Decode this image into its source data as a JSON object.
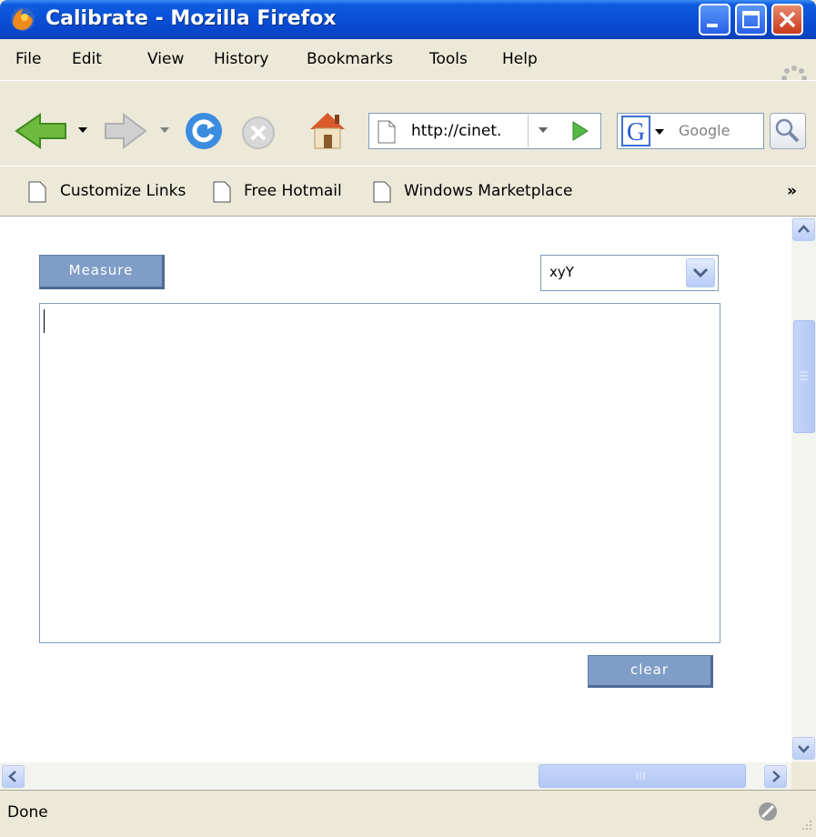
{
  "window": {
    "title": "Calibrate - Mozilla Firefox"
  },
  "menubar": {
    "items": [
      "File",
      "Edit",
      "View",
      "History",
      "Bookmarks",
      "Tools",
      "Help"
    ]
  },
  "navbar": {
    "url": "http://cinet.",
    "search_placeholder": "Google"
  },
  "bookmarks": {
    "items": [
      "Customize Links",
      "Free Hotmail",
      "Windows Marketplace"
    ],
    "overflow": "»"
  },
  "page": {
    "measure_label": "Measure",
    "colorspace_selected": "xyY",
    "output_text": "",
    "clear_label": "clear"
  },
  "status": {
    "text": "Done"
  },
  "colors": {
    "button_bg": "#7F9DC7",
    "titlebar": "#0A4FD6",
    "chrome_bg": "#ECE9D8"
  }
}
